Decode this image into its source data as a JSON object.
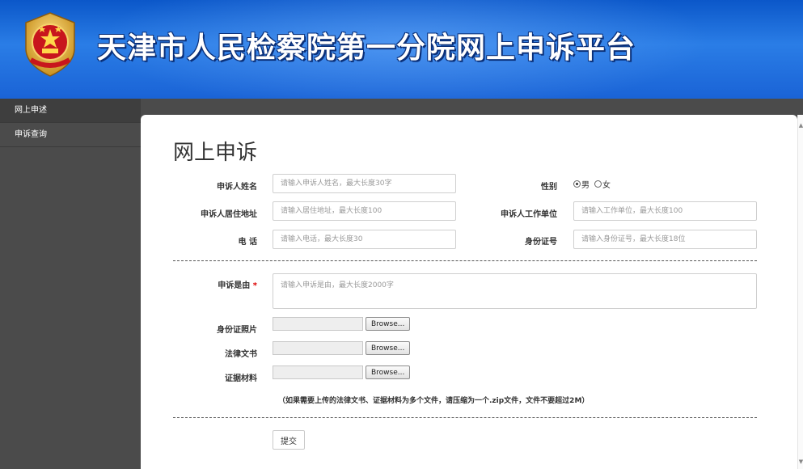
{
  "header": {
    "title": "天津市人民检察院第一分院网上申诉平台",
    "emblem_text": "中国检察 ZHONG GUO JIAN CHA"
  },
  "sidebar": {
    "items": [
      {
        "label": "网上申述",
        "active": true
      },
      {
        "label": "申诉查询",
        "active": false
      }
    ]
  },
  "form": {
    "title": "网上申诉",
    "name": {
      "label": "申诉人姓名",
      "value": "",
      "placeholder": "请输入申诉人姓名，最大长度30字"
    },
    "gender": {
      "label": "性别",
      "options": [
        "男",
        "女"
      ],
      "selected": "男"
    },
    "address": {
      "label": "申诉人居住地址",
      "value": "",
      "placeholder": "请输入居住地址，最大长度100"
    },
    "workplace": {
      "label": "申诉人工作单位",
      "value": "",
      "placeholder": "请输入工作单位，最大长度100"
    },
    "phone": {
      "label": "电  话",
      "value": "",
      "placeholder": "请输入电话，最大长度30"
    },
    "idnum": {
      "label": "身份证号",
      "value": "",
      "placeholder": "请输入身份证号，最大长度18位"
    },
    "reason": {
      "label": "申诉是由",
      "required_mark": "*",
      "value": "",
      "placeholder": "请输入申诉是由，最大长度2000字"
    },
    "id_photo": {
      "label": "身份证照片",
      "button": "Browse..."
    },
    "legal_doc": {
      "label": "法律文书",
      "button": "Browse..."
    },
    "evidence": {
      "label": "证据材料",
      "button": "Browse..."
    },
    "note": "（如果需要上传的法律文书、证据材料为多个文件，请压缩为一个.zip文件，文件不要超过2M）",
    "submit": "提交"
  },
  "colors": {
    "header_blue": "#1a63d6",
    "sidebar_bg": "#4b4b4b",
    "required_red": "#dd0000"
  }
}
